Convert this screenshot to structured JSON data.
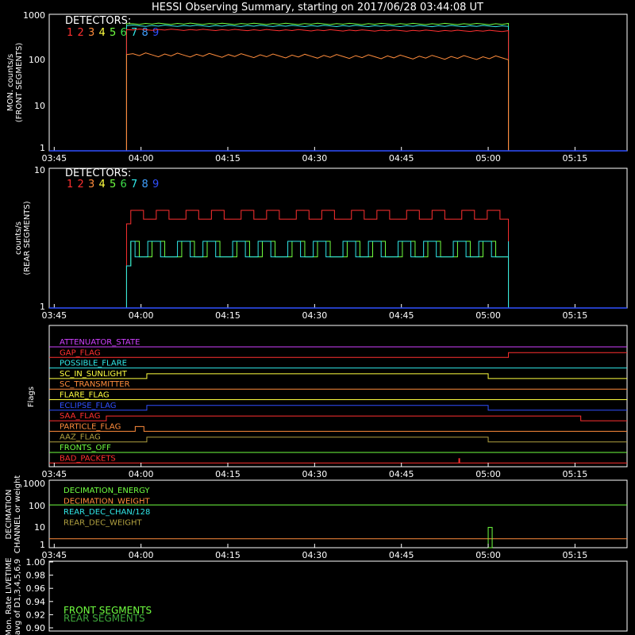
{
  "title": "HESSI Observing Summary, starting on 2017/06/28 03:44:08 UT",
  "colors": {
    "background": "#000000",
    "axes": "#ffffff",
    "detectors": [
      "#ff3030",
      "#ff3030",
      "#ff8c3c",
      "#ffff40",
      "#70ff40",
      "#3ee04a",
      "#30e8e8",
      "#40a0ff",
      "#3050ff"
    ]
  },
  "time_ticks": [
    "03:45",
    "04:00",
    "04:15",
    "04:30",
    "04:45",
    "05:00",
    "05:15"
  ],
  "panels": {
    "front": {
      "ylabel_1": "MON. counts/s",
      "ylabel_2": "(FRONT SEGMENTS)",
      "yticks": [
        "1",
        "10",
        "100",
        "1000"
      ],
      "legend_title": "DETECTORS:",
      "legend_numbers": [
        "1",
        "2",
        "3",
        "4",
        "5",
        "6",
        "7",
        "8",
        "9"
      ]
    },
    "rear": {
      "ylabel_1": "counts/s",
      "ylabel_2": "(REAR SEGMENTS)",
      "yticks": [
        "1",
        "10"
      ],
      "legend_title": "DETECTORS:",
      "legend_numbers": [
        "1",
        "2",
        "3",
        "4",
        "5",
        "6",
        "7",
        "8",
        "9"
      ]
    },
    "flags": {
      "ylabel": "Flags",
      "items": [
        {
          "label": "ATTENUATOR_STATE",
          "color": "#d040ff"
        },
        {
          "label": "GAP_FLAG",
          "color": "#ff3030"
        },
        {
          "label": "POSSIBLE_FLARE",
          "color": "#30e8e8"
        },
        {
          "label": "SC_IN_SUNLIGHT",
          "color": "#ffff40"
        },
        {
          "label": "SC_TRANSMITTER",
          "color": "#ff8c3c"
        },
        {
          "label": "FLARE_FLAG",
          "color": "#ffff40"
        },
        {
          "label": "ECLIPSE_FLAG",
          "color": "#3050ff"
        },
        {
          "label": "SAA_FLAG",
          "color": "#ff3030"
        },
        {
          "label": "PARTICLE_FLAG",
          "color": "#ff8c3c"
        },
        {
          "label": "AAZ_FLAG",
          "color": "#b0a040"
        },
        {
          "label": "FRONTS_OFF",
          "color": "#70ff40"
        },
        {
          "label": "BAD_PACKETS",
          "color": "#ff3030"
        }
      ]
    },
    "decimation": {
      "ylabel_1": "DECIMATION",
      "ylabel_2": "CHANNEL or weight",
      "yticks": [
        "1",
        "10",
        "100",
        "1000"
      ],
      "items": [
        {
          "label": "DECIMATION_ENERGY",
          "color": "#70ff40"
        },
        {
          "label": "DECIMATION_WEIGHT",
          "color": "#ff8c3c"
        },
        {
          "label": "REAR_DEC_CHAN/128",
          "color": "#30e8e8"
        },
        {
          "label": "REAR_DEC_WEIGHT",
          "color": "#b0a040"
        }
      ]
    },
    "livetime": {
      "ylabel_1": "Mon. Rate LIVETIME",
      "ylabel_2": "avg of D1,3,4,5,6,9",
      "yticks": [
        "0.90",
        "0.92",
        "0.94",
        "0.96",
        "0.98",
        "1.00"
      ],
      "legend": [
        {
          "label": "FRONT SEGMENTS",
          "color": "#70ff40"
        },
        {
          "label": "REAR SEGMENTS",
          "color": "#3ea83a"
        }
      ]
    }
  },
  "chart_data": [
    {
      "type": "line",
      "panel": "front",
      "xaxis": "time_UT",
      "xlim": [
        "03:44:08",
        "05:24:00"
      ],
      "ylim": [
        1,
        1000
      ],
      "ylog": true,
      "series": [
        {
          "color": "#70ff40",
          "x": [
            "03:57:30",
            "05:03:30"
          ],
          "values": [
            620,
            610
          ]
        },
        {
          "color": "#30e8e8",
          "x": [
            "03:57:30",
            "05:03:30"
          ],
          "values": [
            560,
            550
          ]
        },
        {
          "color": "#ff3030",
          "x": [
            "03:57:30",
            "05:03:30"
          ],
          "values": [
            460,
            430
          ]
        },
        {
          "color": "#ff8c3c",
          "x": [
            "03:57:30",
            "05:03:30"
          ],
          "values": [
            130,
            110
          ]
        }
      ]
    },
    {
      "type": "line",
      "panel": "rear",
      "xaxis": "time_UT",
      "xlim": [
        "03:44:08",
        "05:24:00"
      ],
      "ylim": [
        1,
        10
      ],
      "ylog": true,
      "series": [
        {
          "color": "#ff3030",
          "x": [
            "03:57:30",
            "05:03:30"
          ],
          "values_range": [
            3,
            5
          ]
        },
        {
          "color": "#70ff40",
          "x": [
            "03:57:30",
            "05:03:30"
          ],
          "values_range": [
            1,
            3
          ]
        },
        {
          "color": "#30e8e8",
          "x": [
            "03:57:30",
            "05:03:30"
          ],
          "values_range": [
            1,
            3
          ]
        }
      ]
    },
    {
      "type": "line",
      "panel": "flags",
      "xaxis": "time_UT",
      "step_times": {
        "GAP_FLAG": [
          "05:03:30"
        ],
        "SC_IN_SUNLIGHT": [
          "04:01:00",
          "05:00:00"
        ],
        "ECLIPSE_FLAG": [
          "04:01:00",
          "05:00:00"
        ],
        "SAA_FLAG": [
          "03:54:00",
          "05:16:00"
        ],
        "PARTICLE_FLAG": [
          "03:59:00",
          "04:00:30"
        ],
        "AAZ_FLAG": [
          "04:01:00",
          "05:00:00"
        ],
        "BAD_PACKETS": [
          "04:55:00"
        ]
      }
    },
    {
      "type": "line",
      "panel": "decimation",
      "xaxis": "time_UT",
      "ylim": [
        1,
        1000
      ],
      "ylog": true,
      "series": [
        {
          "color": "#70ff40",
          "values": [
            80
          ]
        },
        {
          "color": "#ff8c3c",
          "values": [
            2.5
          ]
        },
        {
          "color": "#b0a040",
          "spike": {
            "x": "05:00:00",
            "value": 8
          }
        }
      ]
    }
  ]
}
